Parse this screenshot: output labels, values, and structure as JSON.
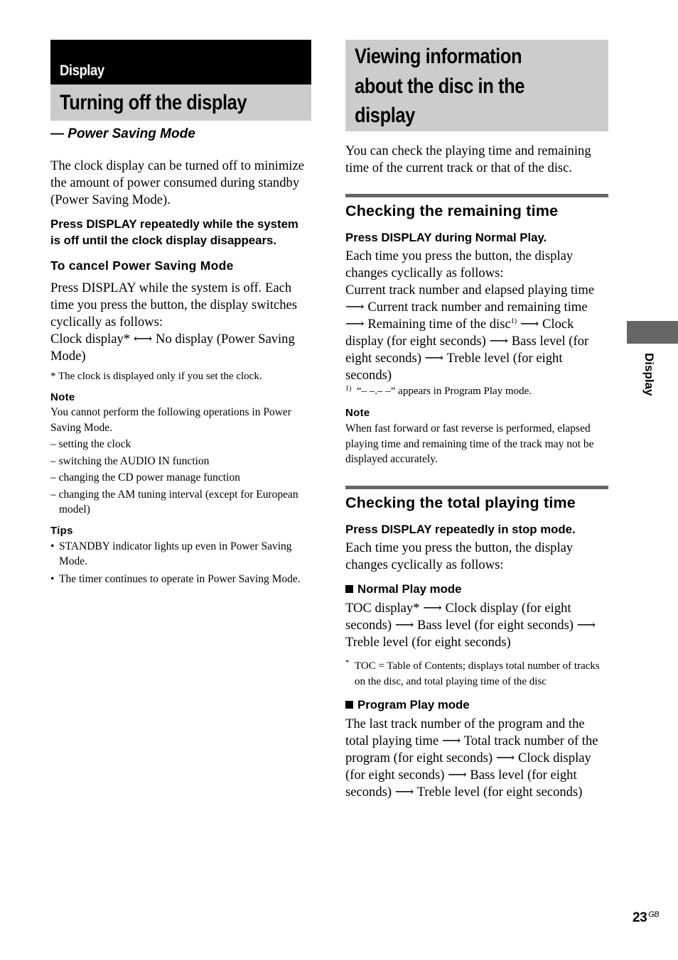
{
  "left": {
    "chapter": "Display",
    "title": "Turning off the display",
    "subtitle": "— Power Saving Mode",
    "intro": "The clock display can be turned off to minimize the amount of power consumed during standby (Power Saving Mode).",
    "step": "Press DISPLAY repeatedly while the system is off until the clock display disappears.",
    "cancel_heading": "To cancel Power Saving Mode",
    "cancel_text": "Press DISPLAY while the system is off. Each time you press the button, the display switches cyclically as follows:",
    "cycle_a": "Clock display*",
    "cycle_arrow": "⟷",
    "cycle_b": "No display (Power Saving Mode)",
    "footnote": "* The clock is displayed only if you set the clock.",
    "note_heading": "Note",
    "note_text": "You cannot perform the following operations in Power Saving Mode.",
    "note_items": [
      "– setting the clock",
      "– switching the AUDIO IN function",
      "– changing the CD power manage function",
      "– changing the AM tuning interval (except for European model)"
    ],
    "tips_heading": "Tips",
    "tips_items": [
      "STANDBY indicator lights up even in Power Saving Mode.",
      "The timer continues to operate in Power Saving Mode."
    ]
  },
  "right": {
    "title": "Viewing information about the disc in the display",
    "title_lines": [
      "Viewing information",
      "about the disc in the",
      "display"
    ],
    "intro": "You can check the playing time and remaining time of the current track or that of the disc.",
    "remaining": {
      "heading": "Checking the remaining time",
      "step": "Press DISPLAY during Normal Play.",
      "text": "Each time you press the button, the display changes cyclically as follows:",
      "seq": [
        "Current track number and elapsed playing time",
        "Current track number and remaining time",
        "Remaining time of the disc",
        "Clock display (for eight seconds)",
        "Bass level (for eight seconds)",
        "Treble level (for eight seconds)"
      ],
      "sup": "1)",
      "footnote_mark": "1)",
      "footnote": "“– –.– –” appears in Program Play mode.",
      "note_heading": "Note",
      "note_text": "When fast forward or fast reverse is performed, elapsed playing time and remaining time of the track may not be displayed accurately."
    },
    "total": {
      "heading": "Checking the total playing time",
      "step": "Press DISPLAY repeatedly in stop mode.",
      "text": "Each time you press the button, the display changes cyclically as follows:",
      "normal_heading": "Normal Play mode",
      "normal_seq": [
        "TOC display*",
        "Clock display (for eight seconds)",
        "Bass level (for eight seconds)",
        "Treble level (for eight seconds)"
      ],
      "toc_mark": "*",
      "toc_note": "TOC = Table of Contents; displays total number of tracks on the disc, and total playing time of the disc",
      "program_heading": "Program Play mode",
      "program_seq": [
        "The last track number of the program and the total playing time",
        "Total track number of the program (for eight seconds)",
        "Clock display (for eight seconds)",
        "Bass level (for eight seconds)",
        "Treble level (for eight seconds)"
      ]
    }
  },
  "arrow": "⟶",
  "side_tab_label": "Display",
  "page_number": "23",
  "page_suffix": "GB"
}
